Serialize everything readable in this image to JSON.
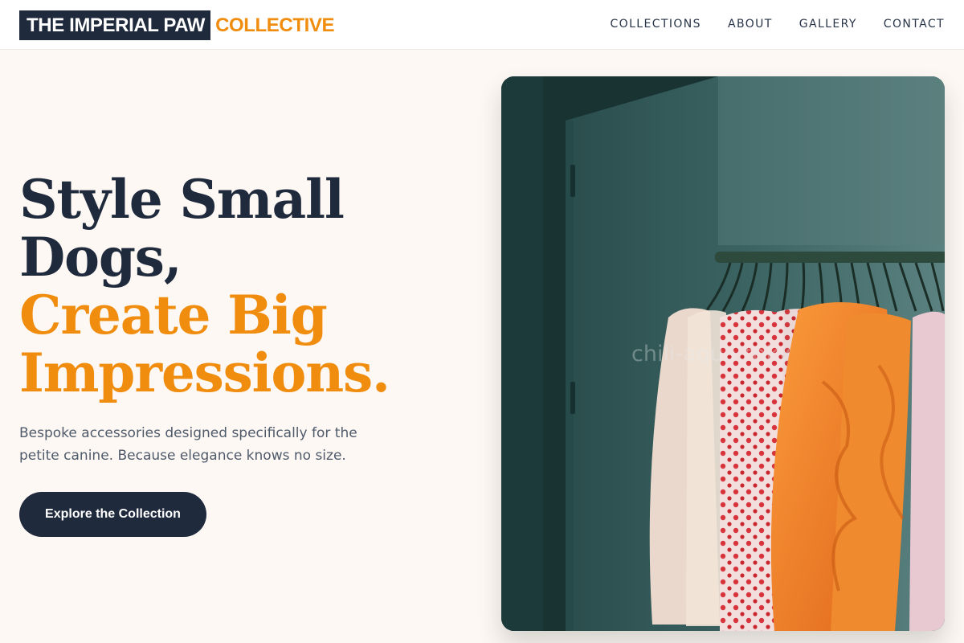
{
  "brand": {
    "dark": "THE IMPERIAL PAW",
    "accent": "COLLECTIVE"
  },
  "nav": {
    "items": [
      "COLLECTIONS",
      "ABOUT",
      "GALLERY",
      "CONTACT"
    ]
  },
  "hero": {
    "title_line1": "Style Small",
    "title_line2": "Dogs,",
    "title_line3": "Create Big",
    "title_line4": "Impressions.",
    "subtitle": "Bespoke accessories designed specifically for the petite canine. Because elegance knows no size.",
    "cta_label": "Explore the Collection"
  },
  "image": {
    "watermark": "chili-aqua.toky"
  },
  "colors": {
    "navy": "#1f2a3d",
    "accent": "#f08c0e",
    "background": "#fdf8f3"
  }
}
